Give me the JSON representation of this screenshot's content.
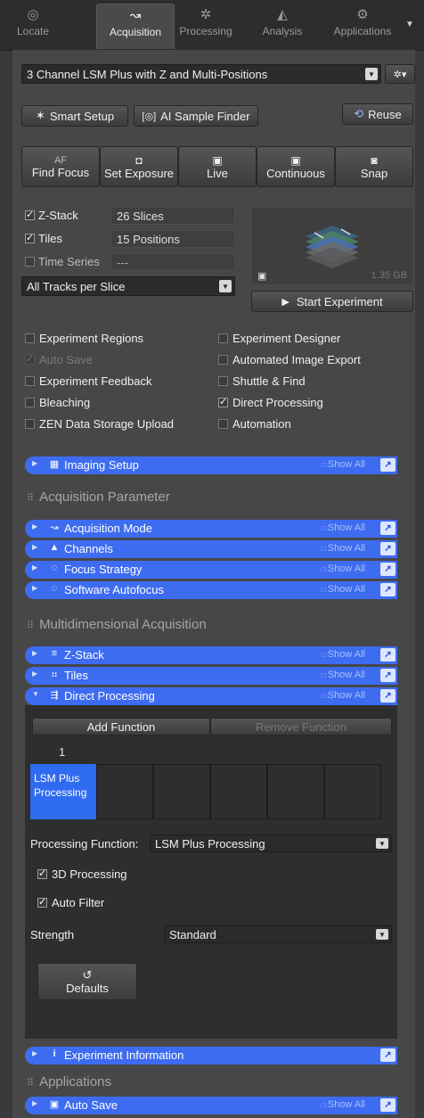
{
  "tabs": [
    {
      "label": "Locate",
      "icon": "locate-icon",
      "glyph": "◎"
    },
    {
      "label": "Acquisition",
      "icon": "acquisition-icon",
      "glyph": "↝"
    },
    {
      "label": "Processing",
      "icon": "processing-icon",
      "glyph": "✲"
    },
    {
      "label": "Analysis",
      "icon": "analysis-icon",
      "glyph": "◭"
    },
    {
      "label": "Applications",
      "icon": "applications-icon",
      "glyph": "⚙"
    }
  ],
  "experiment": {
    "selected": "3 Channel LSM Plus with Z and Multi-Positions"
  },
  "toolbar": {
    "smart_setup": "Smart Setup",
    "ai_finder": "AI Sample Finder",
    "reuse": "Reuse"
  },
  "actions": [
    {
      "label": "Find Focus",
      "glyph": "AF"
    },
    {
      "label": "Set Exposure",
      "glyph": "◘"
    },
    {
      "label": "Live",
      "glyph": "▣"
    },
    {
      "label": "Continuous",
      "glyph": "▣"
    },
    {
      "label": "Snap",
      "glyph": "◙"
    }
  ],
  "dims": {
    "zstack": {
      "label": "Z-Stack",
      "value": "26 Slices",
      "checked": true
    },
    "tiles": {
      "label": "Tiles",
      "value": "15 Positions",
      "checked": true
    },
    "time": {
      "label": "Time Series",
      "value": "---",
      "checked": false
    },
    "tracks": "All Tracks per Slice",
    "size": "1.35 GB",
    "start": "Start Experiment"
  },
  "options_left": [
    {
      "label": "Experiment Regions",
      "checked": false,
      "dim": false
    },
    {
      "label": "Auto Save",
      "checked": true,
      "dim": true
    },
    {
      "label": "Experiment Feedback",
      "checked": false,
      "dim": false
    },
    {
      "label": "Bleaching",
      "checked": false,
      "dim": false
    },
    {
      "label": "ZEN Data Storage Upload",
      "checked": false,
      "dim": false
    }
  ],
  "options_right": [
    {
      "label": "Experiment Designer",
      "checked": false
    },
    {
      "label": "Automated Image Export",
      "checked": false
    },
    {
      "label": "Shuttle & Find",
      "checked": false
    },
    {
      "label": "Direct Processing",
      "checked": true
    },
    {
      "label": "Automation",
      "checked": false
    }
  ],
  "show_all": "Show All",
  "sections": {
    "imaging_setup": "Imaging Setup",
    "acq_group": "Acquisition Parameter",
    "acq_mode": "Acquisition Mode",
    "channels": "Channels",
    "focus": "Focus Strategy",
    "autofocus": "Software Autofocus",
    "md_group": "Multidimensional Acquisition",
    "zstack": "Z-Stack",
    "tiles": "Tiles",
    "direct": "Direct Processing",
    "exp_info": "Experiment Information",
    "app_group": "Applications",
    "autosave": "Auto Save"
  },
  "direct_processing": {
    "add": "Add Function",
    "remove": "Remove Function",
    "slot_number": "1",
    "slot_label_1": "LSM Plus",
    "slot_label_2": "Processing",
    "function_label": "Processing Function:",
    "function_value": "LSM Plus Processing",
    "opt_3d": "3D Processing",
    "opt_filter": "Auto Filter",
    "strength_label": "Strength",
    "strength_value": "Standard",
    "defaults": "Defaults"
  }
}
